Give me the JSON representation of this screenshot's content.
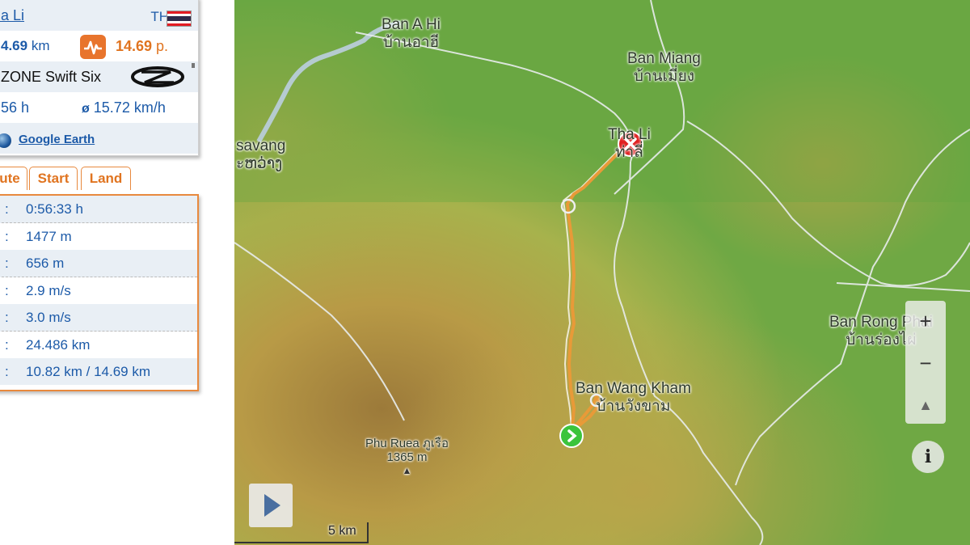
{
  "info": {
    "place": "ha Li",
    "country": "TH",
    "distance": "4.69",
    "distance_unit": " km",
    "points": "14.69",
    "points_unit": " p.",
    "bike": "ZONE Swift Six",
    "duration": "56 h",
    "avg_symbol": "ø",
    "avg_speed": " 15.72 km/h",
    "google_earth": "Google Earth",
    "flag_colors": [
      "#e31b23",
      "#ffffff",
      "#2d2a4a",
      "#ffffff",
      "#e31b23"
    ]
  },
  "tabs": [
    "ute",
    "Start",
    "Land"
  ],
  "stats": [
    {
      "colon": ":",
      "value": "0:56:33 h"
    },
    {
      "colon": ":",
      "value": "1477 m"
    },
    {
      "colon": ":",
      "value": "656 m"
    },
    {
      "colon": ":",
      "value": "2.9 m/s"
    },
    {
      "colon": ":",
      "value": "3.0 m/s"
    },
    {
      "colon": ":",
      "value": "24.486 km"
    },
    {
      "colon": ":",
      "value": "10.82 km / 14.69 km"
    }
  ],
  "map": {
    "labels": {
      "ban_a_hi": "Ban A Hi",
      "ban_a_hi_th": "บ้านอาฮี",
      "ban_miang": "Ban Miang",
      "ban_miang_th": "บ้านเมี่ยง",
      "tha_li": "Tha Li",
      "tha_li_th": "ท่าลี่",
      "savang": "savang",
      "savang_th": "ะຫວ່າງ",
      "ban_rong_phai": "Ban Rong Phai",
      "ban_rong_phai_th": "บ้านร่องไผ่",
      "ban_wang_kham": "Ban Wang Kham",
      "ban_wang_kham_th": "บ้านวังขาม",
      "phu_ruea": "Phu Ruea ภูเรือ",
      "phu_ruea_elev": "1365 m",
      "peak_symbol": "▲"
    },
    "controls": {
      "zoom_in": "+",
      "zoom_out": "−",
      "compass": "▲",
      "info": "i"
    },
    "scale": "5 km",
    "track_color": "#f0a040",
    "start_color": "#3cc43c",
    "end_color": "#e02020"
  }
}
